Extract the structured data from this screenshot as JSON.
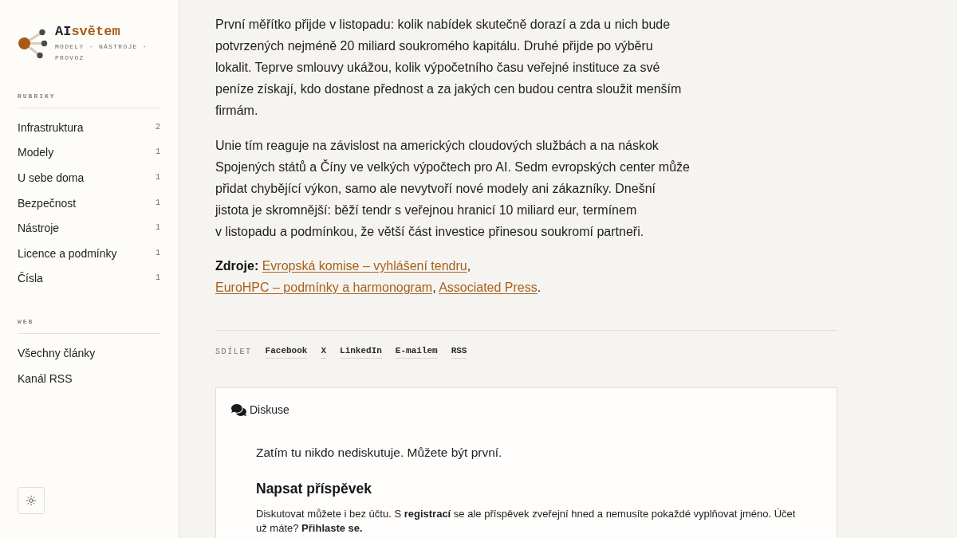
{
  "sidebar": {
    "logo": {
      "title_parts": [
        "AI",
        "světem"
      ],
      "tagline": "MODELY · NÁSTROJE · PROVOZ"
    },
    "sections": [
      {
        "heading": "RUBRIKY",
        "items": [
          {
            "label": "Infrastruktura",
            "count": "2"
          },
          {
            "label": "Modely",
            "count": "1"
          },
          {
            "label": "U sebe doma",
            "count": "1"
          },
          {
            "label": "Bezpečnost",
            "count": "1"
          },
          {
            "label": "Nástroje",
            "count": "1"
          },
          {
            "label": "Licence a podmínky",
            "count": "1"
          },
          {
            "label": "Čísla",
            "count": "1"
          }
        ]
      },
      {
        "heading": "WEB",
        "items": [
          {
            "label": "Všechny články"
          },
          {
            "label": "Kanál RSS"
          }
        ]
      }
    ]
  },
  "article": {
    "paragraphs": [
      "První měřítko přijde v listopadu: kolik nabídek skutečně dorazí a zda u nich bude potvrzených nejméně 20 miliard soukromého kapitálu. Druhé přijde po výběru lokalit. Teprve smlouvy ukážou, kolik výpočetního času veřejné instituce za své peníze získají, kdo dostane přednost a za jakých cen budou centra sloužit menším firmám.",
      "Unie tím reaguje na závislost na amerických cloudových službách a na náskok Spojených států a Číny ve velkých výpočtech pro AI. Sedm evropských center může přidat chybějící výkon, samo ale nevytvoří nové modely ani zákazníky. Dnešní jistota je skromnější: běží tendr s veřejnou hranicí 10 miliard eur, termínem v listopadu a podmínkou, že větší část investice přinesou soukromí partneři."
    ],
    "sources": [
      {
        "kind": "label",
        "text": "Zdroje:"
      },
      {
        "kind": "link",
        "text": "Evropská komise – vyhlášení tendru"
      },
      {
        "kind": "text",
        "text": ","
      },
      {
        "kind": "link",
        "text": "EuroHPC – podmínky a harmonogram"
      },
      {
        "kind": "text",
        "text": ","
      },
      {
        "kind": "link",
        "text": "Associated Press"
      },
      {
        "kind": "text",
        "text": "."
      }
    ],
    "share": {
      "label": "SDÍLET",
      "links": [
        "Facebook",
        "X",
        "LinkedIn",
        "E-mailem",
        "RSS"
      ]
    }
  },
  "discussion": {
    "title": "Diskuse",
    "empty_message": "Zatím tu nikdo nediskutuje. Můžete být první.",
    "form_heading": "Napsat příspěvek",
    "note": "Diskutovat můžete i bez účtu. S **registrací** se ale příspěvek zveřejní hned a nemusíte pokaždé vyplňovat jméno. Účet už máte? **Přihlaste se.**"
  }
}
